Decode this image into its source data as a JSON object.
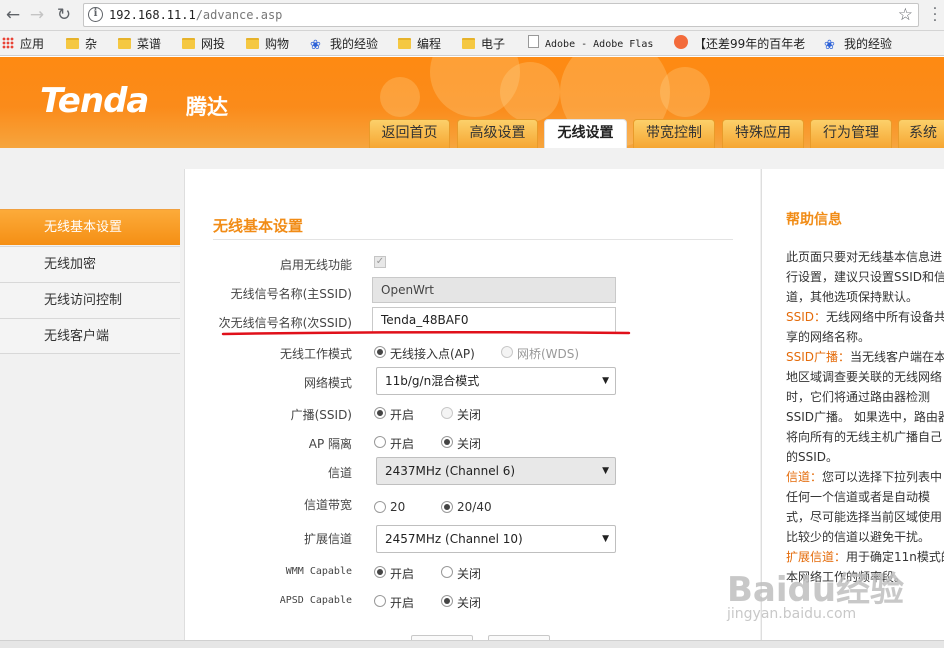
{
  "browser": {
    "url_host": "192.168.11.1",
    "url_path": "/advance.asp",
    "bookmarks": [
      {
        "label": "应用",
        "icon": "apps-icon"
      },
      {
        "label": "杂",
        "icon": "folder-icon"
      },
      {
        "label": "菜谱",
        "icon": "folder-icon"
      },
      {
        "label": "网投",
        "icon": "folder-icon"
      },
      {
        "label": "购物",
        "icon": "folder-icon"
      },
      {
        "label": "我的经验",
        "icon": "baidu-paw-icon"
      },
      {
        "label": "编程",
        "icon": "folder-icon"
      },
      {
        "label": "电子",
        "icon": "folder-icon"
      },
      {
        "label": "Adobe - Adobe Flas",
        "icon": "page-icon"
      },
      {
        "label": "【还差99年的百年老",
        "icon": "orange-icon"
      },
      {
        "label": "我的经验",
        "icon": "baidu-paw-icon"
      }
    ]
  },
  "header": {
    "logo": "Tenda",
    "logo_cn": "腾达",
    "tabs": [
      {
        "label": "返回首页"
      },
      {
        "label": "高级设置"
      },
      {
        "label": "无线设置",
        "active": true
      },
      {
        "label": "带宽控制"
      },
      {
        "label": "特殊应用"
      },
      {
        "label": "行为管理"
      },
      {
        "label": "系统"
      }
    ]
  },
  "sidebar": {
    "items": [
      {
        "label": "无线基本设置",
        "active": true
      },
      {
        "label": "无线加密"
      },
      {
        "label": "无线访问控制"
      },
      {
        "label": "无线客户端"
      }
    ]
  },
  "form": {
    "title": "无线基本设置",
    "enable_label": "启用无线功能",
    "enable_checked": true,
    "ssid_main_label": "无线信号名称(主SSID)",
    "ssid_main_value": "OpenWrt",
    "ssid_sub_label": "次无线信号名称(次SSID)",
    "ssid_sub_value": "Tenda_48BAF0",
    "mode_label": "无线工作模式",
    "mode_ap": "无线接入点(AP)",
    "mode_wds": "网桥(WDS)",
    "netmode_label": "网络模式",
    "netmode_value": "11b/g/n混合模式",
    "broadcast_label": "广播(SSID)",
    "on": "开启",
    "off": "关闭",
    "isolation_label": "AP 隔离",
    "channel_label": "信道",
    "channel_value": "2437MHz (Channel 6)",
    "bandwidth_label": "信道带宽",
    "bw_20": "20",
    "bw_2040": "20/40",
    "ext_channel_label": "扩展信道",
    "ext_channel_value": "2457MHz (Channel 10)",
    "wmm_label": "WMM Capable",
    "apsd_label": "APSD Capable"
  },
  "help": {
    "title": "帮助信息",
    "lines": [
      {
        "text": "此页面只要对无线基本信息进"
      },
      {
        "text": "行设置，建议只设置SSID和信"
      },
      {
        "text": "道，其他选项保持默认。"
      },
      {
        "hl": "SSID：",
        "text": "无线网络中所有设备共"
      },
      {
        "text": "享的网络名称。"
      },
      {
        "hl": "SSID广播：",
        "text": "当无线客户端在本"
      },
      {
        "text": "地区域调查要关联的无线网络"
      },
      {
        "text": "时，它们将通过路由器检测"
      },
      {
        "text": "SSID广播。 如果选中，路由器"
      },
      {
        "text": "将向所有的无线主机广播自己"
      },
      {
        "text": "的SSID。"
      },
      {
        "hl": "信道：",
        "text": "您可以选择下拉列表中"
      },
      {
        "text": "任何一个信道或者是自动模"
      },
      {
        "text": "式，尽可能选择当前区域使用"
      },
      {
        "text": "比较少的信道以避免干扰。"
      },
      {
        "hl": "扩展信道：",
        "text": "用于确定11n模式的"
      },
      {
        "text": "本网络工作的频率段。"
      }
    ]
  },
  "watermark": {
    "main": "Baidu经验",
    "sub": "jingyan.baidu.com"
  },
  "colors": {
    "accent_orange": "#f18c16",
    "annotation_red": "#e0101a"
  }
}
